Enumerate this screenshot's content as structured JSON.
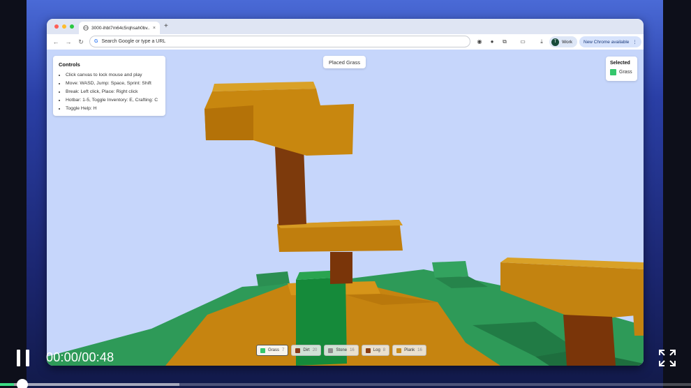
{
  "browser": {
    "tab_title": "3000-ihbt7m64c5rqhsah0bv...",
    "tab_close": "×",
    "new_tab": "+",
    "omnibox_placeholder": "Search Google or type a URL",
    "google_g": "G",
    "profile_initial": "T",
    "profile_label": "Work",
    "update_label": "New Chrome available",
    "update_more": "⋮"
  },
  "controls": {
    "title": "Controls",
    "items": [
      "Click canvas to lock mouse and play",
      "Move: WASD, Jump: Space, Sprint: Shift",
      "Break: Left click, Place: Right click",
      "Hotbar: 1-5, Toggle Inventory: E, Crafting: C",
      "Toggle Help: H"
    ]
  },
  "toast": "Placed Grass",
  "selected": {
    "title": "Selected",
    "block": "Grass",
    "color": "#35c76c"
  },
  "hotbar": [
    {
      "name": "Grass",
      "count": "7",
      "color": "#35c76c"
    },
    {
      "name": "Dirt",
      "count": "20",
      "color": "#8a3a1a"
    },
    {
      "name": "Stone",
      "count": "16",
      "color": "#8d8d8d"
    },
    {
      "name": "Log",
      "count": "8",
      "color": "#8b3d12"
    },
    {
      "name": "Plank",
      "count": "16",
      "color": "#c98c1c"
    }
  ],
  "player": {
    "time": "00:00/00:48",
    "progress_played": 0.02,
    "progress_buffered": 0.26
  },
  "colors": {
    "sky": "#c6d6fb",
    "grass": "#2e9a58",
    "plank": "#c98510",
    "log": "#7a3a0e"
  }
}
